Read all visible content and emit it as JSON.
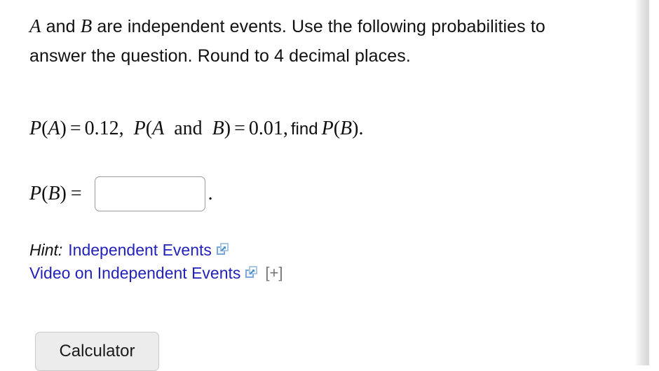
{
  "problem": {
    "statement_prefix": "",
    "var_a": "A",
    "text_and": " and ",
    "var_b": "B",
    "statement_rest": " are independent events. Use the following probabilities to answer the question. Round to 4 decimal places."
  },
  "given": {
    "p_label_1": "P",
    "open_1": "(",
    "arg_1": "A",
    "close_1": ")",
    "equals_1": "=",
    "value_1": "0.12,",
    "p_label_2": "P",
    "open_2": "(",
    "arg_2a": "A",
    "and_word": "and",
    "arg_2b": "B",
    "close_2": ")",
    "equals_2": "=",
    "value_2": "0.01,",
    "find_word": "find",
    "p_label_3": "P",
    "open_3": "(",
    "arg_3": "B",
    "close_3": ")",
    "period": "."
  },
  "answer": {
    "label_p": "P",
    "label_open": "(",
    "label_var": "B",
    "label_close": ")",
    "label_equals": "=",
    "input_value": "",
    "input_placeholder": "",
    "trailing_period": "."
  },
  "hints": {
    "hint_label": "Hint:",
    "link_1": "Independent Events",
    "link_2": "Video on Independent Events",
    "expand_toggle": "[+]",
    "external_icon_name": "external-link-icon"
  },
  "actions": {
    "calculator_label": "Calculator"
  },
  "colors": {
    "link_blue": "#2222bb",
    "text_black": "#111111",
    "button_gray": "#ececec",
    "border_gray": "#9a9a9a",
    "toggle_gray": "#767676"
  }
}
